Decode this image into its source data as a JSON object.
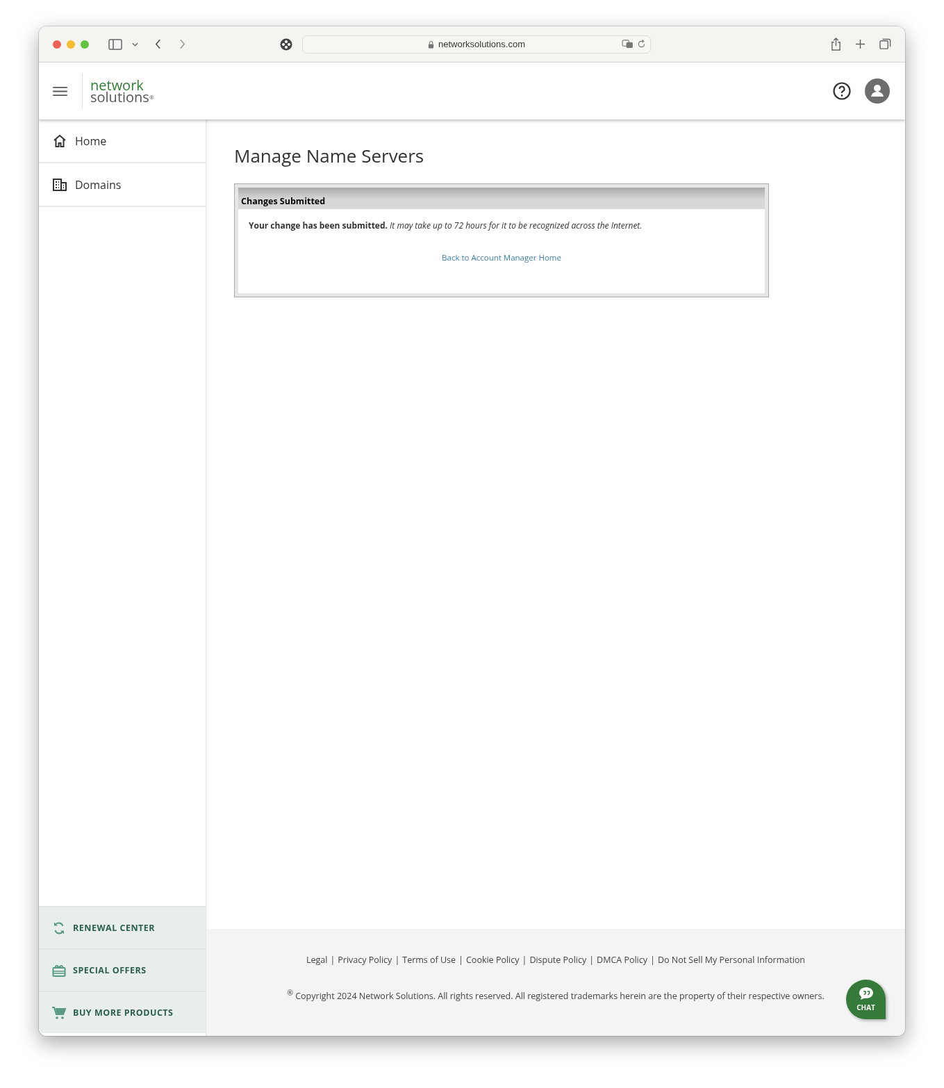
{
  "browser": {
    "url": "networksolutions.com"
  },
  "logo": {
    "line1": "network",
    "line2": "solutions",
    "mark": "®"
  },
  "sidebar": {
    "items": [
      {
        "label": "Home"
      },
      {
        "label": "Domains"
      }
    ],
    "promos": [
      {
        "label": "RENEWAL CENTER"
      },
      {
        "label": "SPECIAL OFFERS"
      },
      {
        "label": "BUY MORE PRODUCTS"
      }
    ]
  },
  "page": {
    "title": "Manage Name Servers"
  },
  "panel": {
    "title": "Changes Submitted",
    "message": "**Your change has been submitted.** *It may take up to 72 hours for it to be recognized across the Internet.*",
    "link": "Back to Account Manager Home"
  },
  "footer": {
    "separator": "|",
    "links": [
      "Legal",
      "Privacy Policy",
      "Terms of Use",
      "Cookie Policy",
      "Dispute Policy",
      "DMCA Policy",
      "Do Not Sell My Personal Information"
    ],
    "copyright": "$^{®}$ Copyright 2024 Network Solutions. All rights reserved. All registered trademarks herein are the property of their respective owners."
  },
  "chat": {
    "label": "CHAT"
  }
}
